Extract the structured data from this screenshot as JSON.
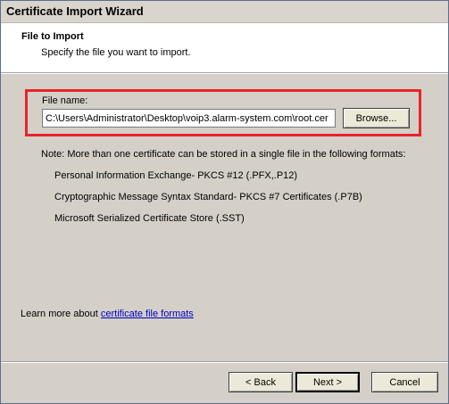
{
  "window": {
    "title": "Certificate Import Wizard"
  },
  "header": {
    "title": "File to Import",
    "subtitle": "Specify the file you want to import."
  },
  "file_field": {
    "label": "File name:",
    "value": "C:\\Users\\Administrator\\Desktop\\voip3.alarm-system.com\\root.cer",
    "browse_label": "Browse..."
  },
  "note": "Note:  More than one certificate can be stored in a single file in the following formats:",
  "formats": [
    "Personal Information Exchange- PKCS #12 (.PFX,.P12)",
    "Cryptographic Message Syntax Standard- PKCS #7 Certificates (.P7B)",
    "Microsoft Serialized Certificate Store (.SST)"
  ],
  "learn_more": {
    "prefix": "Learn more about ",
    "link": "certificate file formats"
  },
  "buttons": {
    "back": "< Back",
    "next": "Next >",
    "cancel": "Cancel"
  },
  "colors": {
    "highlight": "#e8242a",
    "link": "#0000c0",
    "dialog_bg": "#d4d0c8"
  }
}
